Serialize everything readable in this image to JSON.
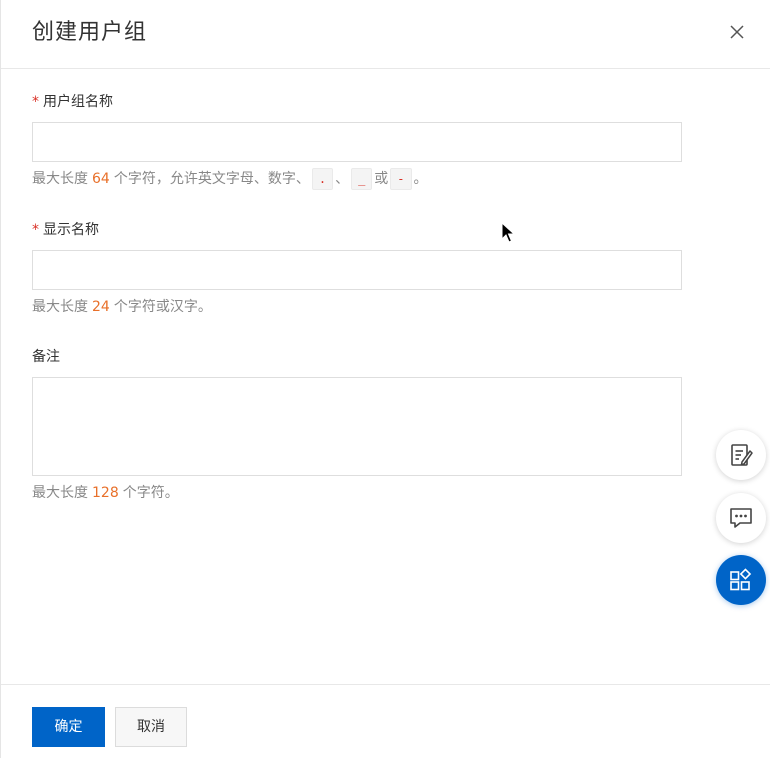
{
  "dialog": {
    "title": "创建用户组"
  },
  "fields": {
    "group_name": {
      "required_mark": "*",
      "label": "用户组名称",
      "value": "",
      "placeholder": "",
      "hint_prefix": "最大长度",
      "hint_max": "64",
      "hint_middle": "个字符，允许英文字母、数字、",
      "hint_char_dot": ".",
      "hint_sep1": "、",
      "hint_char_underscore": "_",
      "hint_or": "或",
      "hint_char_dash": "-",
      "hint_end": "。"
    },
    "display_name": {
      "required_mark": "*",
      "label": "显示名称",
      "value": "",
      "placeholder": "",
      "hint_prefix": "最大长度",
      "hint_max": "24",
      "hint_suffix": "个字符或汉字。"
    },
    "remark": {
      "label": "备注",
      "value": "",
      "placeholder": "",
      "hint_prefix": "最大长度",
      "hint_max": "128",
      "hint_suffix": "个字符。"
    }
  },
  "footer": {
    "confirm_label": "确定",
    "cancel_label": "取消"
  },
  "floating_tools": [
    {
      "icon": "edit-note-icon",
      "active": false
    },
    {
      "icon": "chat-icon",
      "active": false
    },
    {
      "icon": "apps-icon",
      "active": true
    }
  ],
  "colors": {
    "primary": "#0064c8",
    "required": "#d93026",
    "number_highlight": "#e8702a",
    "hint_text": "#888888"
  }
}
